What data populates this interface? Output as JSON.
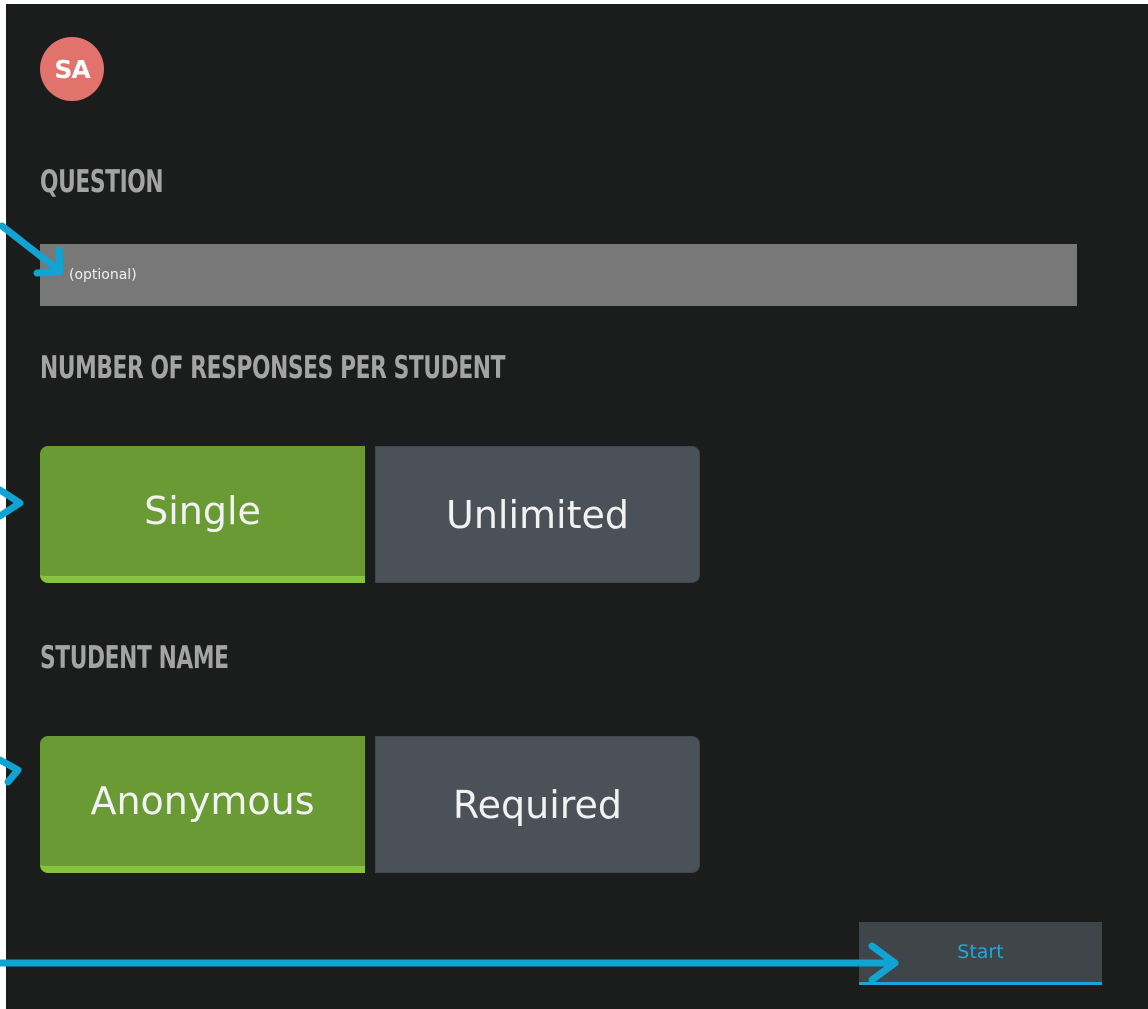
{
  "avatar": {
    "initials": "SA",
    "color": "#e2736c"
  },
  "question": {
    "heading": "QUESTION",
    "placeholder": "(optional)",
    "value": ""
  },
  "responses": {
    "heading": "NUMBER OF RESPONSES PER STUDENT",
    "options": [
      {
        "label": "Single",
        "selected": true
      },
      {
        "label": "Unlimited",
        "selected": false
      }
    ]
  },
  "student_name": {
    "heading": "STUDENT NAME",
    "options": [
      {
        "label": "Anonymous",
        "selected": true
      },
      {
        "label": "Required",
        "selected": false
      }
    ]
  },
  "actions": {
    "start_label": "Start"
  },
  "colors": {
    "background": "#1b1c1c",
    "selected": "#6a9a34",
    "unselected": "#4a5159",
    "accent": "#1aa6d8",
    "annotation_arrow": "#11a3d2"
  },
  "annotations": {
    "arrow_icon": "arrow-right-icon",
    "count": 4
  }
}
